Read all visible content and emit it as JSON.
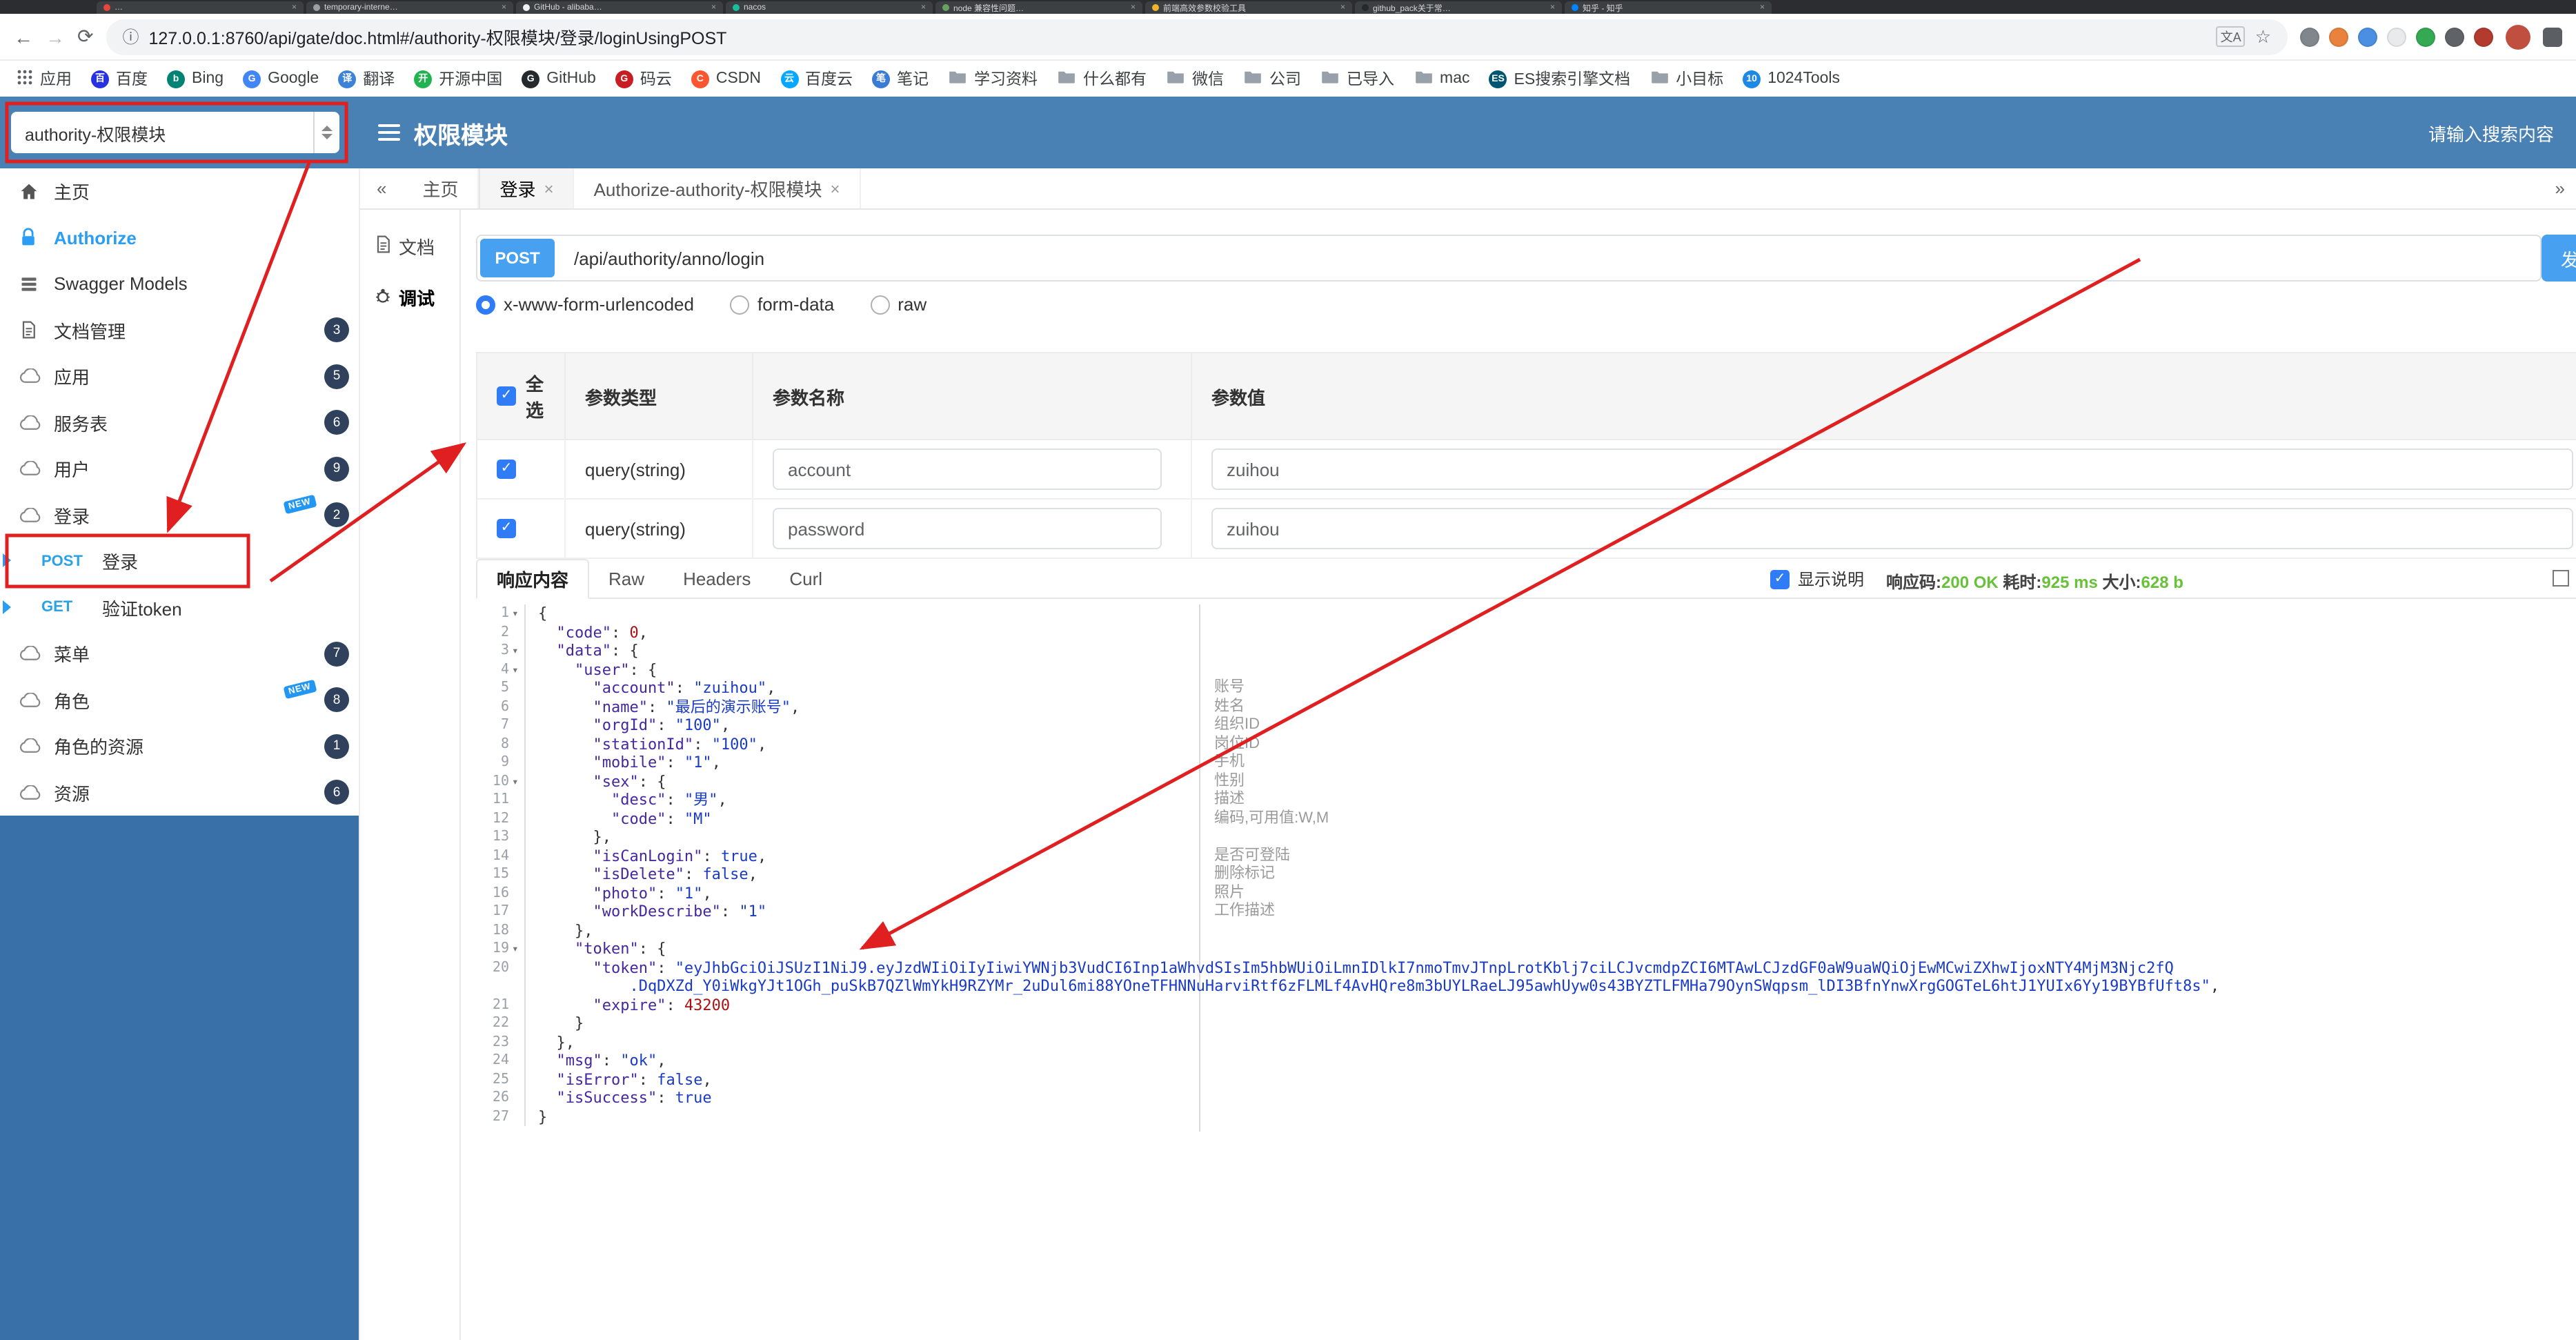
{
  "colors": {
    "header_blue": "#4a81b4",
    "sidebar_blue": "#3a70a8",
    "method_badge": "#47a0f0",
    "accent_blue": "#2a9df4",
    "badge_navy": "#30415d",
    "status_green": "#67c23a",
    "annotation_red": "#e02020"
  },
  "browser": {
    "tabs": [
      {
        "title": "…",
        "color": "#e8453c"
      },
      {
        "title": "temporary-interne…",
        "color": "#9aa0a6"
      },
      {
        "title": "GitHub - alibaba…",
        "color": "#f1f1f1"
      },
      {
        "title": "nacos",
        "color": "#1abc9c"
      },
      {
        "title": "node 兼容性问题…",
        "color": "#68a063"
      },
      {
        "title": "前端高效参数校验工具",
        "color": "#f0b429"
      },
      {
        "title": "github_pack关于常…",
        "color": "#24292e"
      },
      {
        "title": "知乎 - 知乎",
        "color": "#0084ff"
      }
    ],
    "address": {
      "url": "127.0.0.1:8760/api/gate/doc.html#/authority-权限模块/登录/loginUsingPOST"
    },
    "extensions": [
      {
        "color": "#7f868c"
      },
      {
        "color": "#e8823c"
      },
      {
        "color": "#4a8fe2"
      },
      {
        "color": "#e9eaec"
      },
      {
        "color": "#35a853"
      },
      {
        "color": "#5f6368"
      },
      {
        "color": "#b23b2e"
      }
    ],
    "bookmarks": [
      {
        "label": "应用",
        "icon": "apps"
      },
      {
        "label": "百度",
        "icon": "site",
        "color": "#2932e1",
        "letter": "百"
      },
      {
        "label": "Bing",
        "icon": "site",
        "color": "#008373",
        "letter": "b"
      },
      {
        "label": "Google",
        "icon": "site",
        "color": "#4285f4",
        "letter": "G"
      },
      {
        "label": "翻译",
        "icon": "site",
        "color": "#3b82d8",
        "letter": "译"
      },
      {
        "label": "开源中国",
        "icon": "site",
        "color": "#21b351",
        "letter": "开"
      },
      {
        "label": "GitHub",
        "icon": "site",
        "color": "#24292e",
        "letter": "G"
      },
      {
        "label": "码云",
        "icon": "site",
        "color": "#c71d23",
        "letter": "G"
      },
      {
        "label": "CSDN",
        "icon": "site",
        "color": "#fc5531",
        "letter": "C"
      },
      {
        "label": "百度云",
        "icon": "site",
        "color": "#06a7ff",
        "letter": "云"
      },
      {
        "label": "笔记",
        "icon": "site",
        "color": "#3a7bd5",
        "letter": "笔"
      },
      {
        "label": "学习资料",
        "icon": "folder"
      },
      {
        "label": "什么都有",
        "icon": "folder"
      },
      {
        "label": "微信",
        "icon": "folder"
      },
      {
        "label": "公司",
        "icon": "folder"
      },
      {
        "label": "已导入",
        "icon": "folder"
      },
      {
        "label": "mac",
        "icon": "folder"
      },
      {
        "label": "ES搜索引擎文档",
        "icon": "site",
        "color": "#005571",
        "letter": "ES"
      },
      {
        "label": "小目标",
        "icon": "folder"
      },
      {
        "label": "1024Tools",
        "icon": "site",
        "color": "#1e88e5",
        "letter": "10"
      }
    ]
  },
  "header": {
    "module_select": "authority-权限模块",
    "title": "权限模块",
    "search_placeholder": "请输入搜索内容"
  },
  "sidebar": {
    "items": [
      {
        "key": "home",
        "label": "主页",
        "icon": "home"
      },
      {
        "key": "authorize",
        "label": "Authorize",
        "icon": "lock",
        "style": "auth"
      },
      {
        "key": "swagger-models",
        "label": "Swagger Models",
        "icon": "models"
      },
      {
        "key": "doc-manage",
        "label": "文档管理",
        "icon": "file",
        "badge": "3"
      },
      {
        "key": "app",
        "label": "应用",
        "icon": "cloud",
        "badge": "5"
      },
      {
        "key": "service",
        "label": "服务表",
        "icon": "cloud",
        "badge": "6"
      },
      {
        "key": "user",
        "label": "用户",
        "icon": "cloud",
        "badge": "9"
      },
      {
        "key": "login",
        "label": "登录",
        "icon": "cloud",
        "badge": "2",
        "new": true
      },
      {
        "key": "post-login",
        "method": "POST",
        "label": "登录"
      },
      {
        "key": "get-verify-token",
        "method": "GET",
        "label": "验证token"
      },
      {
        "key": "menu",
        "label": "菜单",
        "icon": "cloud",
        "badge": "7"
      },
      {
        "key": "role",
        "label": "角色",
        "icon": "cloud",
        "badge": "8",
        "new": true
      },
      {
        "key": "role-resource",
        "label": "角色的资源",
        "icon": "cloud",
        "badge": "1"
      },
      {
        "key": "resource",
        "label": "资源",
        "icon": "cloud",
        "badge": "6"
      }
    ]
  },
  "nav_tabs": [
    {
      "label": "主页",
      "closable": false,
      "active": false
    },
    {
      "label": "登录",
      "closable": true,
      "active": true
    },
    {
      "label": "Authorize-authority-权限模块",
      "closable": true,
      "active": false
    }
  ],
  "doc_tabs": [
    {
      "label": "文档",
      "icon": "file",
      "active": false
    },
    {
      "label": "调试",
      "icon": "bug",
      "active": true
    }
  ],
  "request": {
    "method": "POST",
    "url": "/api/authority/anno/login",
    "send_label": "发送",
    "content_types": [
      "x-www-form-urlencoded",
      "form-data",
      "raw"
    ],
    "selected_type": "x-www-form-urlencoded",
    "table": {
      "headers": [
        "全选",
        "参数类型",
        "参数名称",
        "参数值"
      ],
      "rows": [
        {
          "checked": true,
          "type": "query(string)",
          "name": "account",
          "value": "zuihou"
        },
        {
          "checked": true,
          "type": "query(string)",
          "name": "password",
          "value": "zuihou"
        }
      ]
    }
  },
  "response": {
    "tabs": [
      "响应内容",
      "Raw",
      "Headers",
      "Curl"
    ],
    "active_tab": "响应内容",
    "show_desc_label": "显示说明",
    "status": {
      "code_label": "响应码:",
      "code": "200 OK",
      "time_label": "耗时:",
      "time": "925 ms",
      "size_label": "大小:",
      "size": "628 b"
    },
    "json_lines": [
      {
        "ln": 1,
        "f": true,
        "t": [
          [
            "p",
            "{"
          ]
        ]
      },
      {
        "ln": 2,
        "t": [
          [
            "k",
            "  \"code\""
          ],
          [
            "p",
            ": "
          ],
          [
            "n",
            "0"
          ],
          [
            "p",
            ","
          ]
        ]
      },
      {
        "ln": 3,
        "f": true,
        "t": [
          [
            "k",
            "  \"data\""
          ],
          [
            "p",
            ": {"
          ]
        ]
      },
      {
        "ln": 4,
        "f": true,
        "t": [
          [
            "k",
            "    \"user\""
          ],
          [
            "p",
            ": {"
          ]
        ]
      },
      {
        "ln": 5,
        "t": [
          [
            "k",
            "      \"account\""
          ],
          [
            "p",
            ": "
          ],
          [
            "s",
            "\"zuihou\""
          ],
          [
            "p",
            ","
          ]
        ]
      },
      {
        "ln": 6,
        "t": [
          [
            "k",
            "      \"name\""
          ],
          [
            "p",
            ": "
          ],
          [
            "s",
            "\"最后的演示账号\""
          ],
          [
            "p",
            ","
          ]
        ]
      },
      {
        "ln": 7,
        "t": [
          [
            "k",
            "      \"orgId\""
          ],
          [
            "p",
            ": "
          ],
          [
            "s",
            "\"100\""
          ],
          [
            "p",
            ","
          ]
        ]
      },
      {
        "ln": 8,
        "t": [
          [
            "k",
            "      \"stationId\""
          ],
          [
            "p",
            ": "
          ],
          [
            "s",
            "\"100\""
          ],
          [
            "p",
            ","
          ]
        ]
      },
      {
        "ln": 9,
        "t": [
          [
            "k",
            "      \"mobile\""
          ],
          [
            "p",
            ": "
          ],
          [
            "s",
            "\"1\""
          ],
          [
            "p",
            ","
          ]
        ]
      },
      {
        "ln": 10,
        "f": true,
        "t": [
          [
            "k",
            "      \"sex\""
          ],
          [
            "p",
            ": {"
          ]
        ]
      },
      {
        "ln": 11,
        "t": [
          [
            "k",
            "        \"desc\""
          ],
          [
            "p",
            ": "
          ],
          [
            "s",
            "\"男\""
          ],
          [
            "p",
            ","
          ]
        ]
      },
      {
        "ln": 12,
        "t": [
          [
            "k",
            "        \"code\""
          ],
          [
            "p",
            ": "
          ],
          [
            "s",
            "\"M\""
          ]
        ]
      },
      {
        "ln": 13,
        "t": [
          [
            "p",
            "      },"
          ]
        ]
      },
      {
        "ln": 14,
        "t": [
          [
            "k",
            "      \"isCanLogin\""
          ],
          [
            "p",
            ": "
          ],
          [
            "b",
            "true"
          ],
          [
            "p",
            ","
          ]
        ]
      },
      {
        "ln": 15,
        "t": [
          [
            "k",
            "      \"isDelete\""
          ],
          [
            "p",
            ": "
          ],
          [
            "b",
            "false"
          ],
          [
            "p",
            ","
          ]
        ]
      },
      {
        "ln": 16,
        "t": [
          [
            "k",
            "      \"photo\""
          ],
          [
            "p",
            ": "
          ],
          [
            "s",
            "\"1\""
          ],
          [
            "p",
            ","
          ]
        ]
      },
      {
        "ln": 17,
        "t": [
          [
            "k",
            "      \"workDescribe\""
          ],
          [
            "p",
            ": "
          ],
          [
            "s",
            "\"1\""
          ]
        ]
      },
      {
        "ln": 18,
        "t": [
          [
            "p",
            "    },"
          ]
        ]
      },
      {
        "ln": 19,
        "f": true,
        "t": [
          [
            "k",
            "    \"token\""
          ],
          [
            "p",
            ": {"
          ]
        ]
      },
      {
        "ln": 20,
        "t": [
          [
            "k",
            "      \"token\""
          ],
          [
            "p",
            ": "
          ],
          [
            "s",
            "\"eyJhbGciOiJSUzI1NiJ9.eyJzdWIiOiIyIiwiYWNjb3VudCI6Inp1aWhvdSIsIm5hbWUiOiLmnIDlkI7nmoTmvJTnpLrotKblj7ciLCJvcmdpZCI6MTAwLCJzdGF0aW9uaWQiOjEwMCwiZXhwIjoxNTY4MjM3Njc2fQ"
          ]
        ]
      },
      {
        "ln": null,
        "t": [
          [
            "s",
            "          .DqDXZd_Y0iWkgYJt1OGh_puSkB7QZlWmYkH9RZYMr_2uDul6mi88YOneTFHNNuHarviRtf6zFLMLf4AvHQre8m3bUYLRaeLJ95awhUyw0s43BYZTLFMHa79OynSWqpsm_lDI3BfnYnwXrgGOGTeL6htJ1YUIx6Yy19BYBfUft8s\""
          ],
          [
            "p",
            ","
          ]
        ]
      },
      {
        "ln": 21,
        "t": [
          [
            "k",
            "      \"expire\""
          ],
          [
            "p",
            ": "
          ],
          [
            "n",
            "43200"
          ]
        ]
      },
      {
        "ln": 22,
        "t": [
          [
            "p",
            "    }"
          ]
        ]
      },
      {
        "ln": 23,
        "t": [
          [
            "p",
            "  },"
          ]
        ]
      },
      {
        "ln": 24,
        "t": [
          [
            "k",
            "  \"msg\""
          ],
          [
            "p",
            ": "
          ],
          [
            "s",
            "\"ok\""
          ],
          [
            "p",
            ","
          ]
        ]
      },
      {
        "ln": 25,
        "t": [
          [
            "k",
            "  \"isError\""
          ],
          [
            "p",
            ": "
          ],
          [
            "b",
            "false"
          ],
          [
            "p",
            ","
          ]
        ]
      },
      {
        "ln": 26,
        "t": [
          [
            "k",
            "  \"isSuccess\""
          ],
          [
            "p",
            ": "
          ],
          [
            "b",
            "true"
          ]
        ]
      },
      {
        "ln": 27,
        "t": [
          [
            "p",
            "}"
          ]
        ]
      }
    ],
    "annotations": [
      {
        "line": 5,
        "text": "账号"
      },
      {
        "line": 6,
        "text": "姓名"
      },
      {
        "line": 7,
        "text": "组织ID"
      },
      {
        "line": 8,
        "text": "岗位ID"
      },
      {
        "line": 9,
        "text": "手机"
      },
      {
        "line": 10,
        "text": "性别"
      },
      {
        "line": 11,
        "text": "描述"
      },
      {
        "line": 12,
        "text": "编码,可用值:W,M"
      },
      {
        "line": 14,
        "text": "是否可登陆"
      },
      {
        "line": 15,
        "text": "删除标记"
      },
      {
        "line": 16,
        "text": "照片"
      },
      {
        "line": 17,
        "text": "工作描述"
      }
    ]
  }
}
